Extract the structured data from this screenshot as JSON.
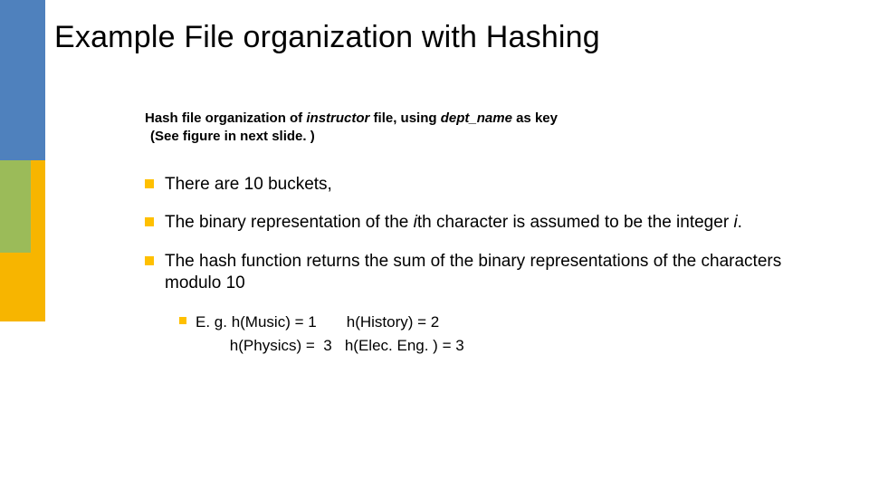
{
  "title": "Example File organization with Hashing",
  "intro": {
    "line1_prefix": "Hash file organization of ",
    "line1_em1": "instructor",
    "line1_mid": " file, using ",
    "line1_em2": "dept_name",
    "line1_suffix": " as key",
    "line2": "(See figure in next slide. )"
  },
  "bullets": [
    {
      "text": "There are 10 buckets,"
    },
    {
      "text_pre": "The binary representation of the ",
      "text_i1": "i",
      "text_mid": "th character is assumed to be the integer ",
      "text_i2": "i",
      "text_suffix": "."
    },
    {
      "text": "The hash function returns the sum of the binary representations of the characters modulo 10"
    }
  ],
  "example": {
    "label": "E. g.",
    "row1": " h(Music) = 1       h(History) = 2",
    "row2": "        h(Physics) =  3   h(Elec. Eng. ) = 3"
  }
}
